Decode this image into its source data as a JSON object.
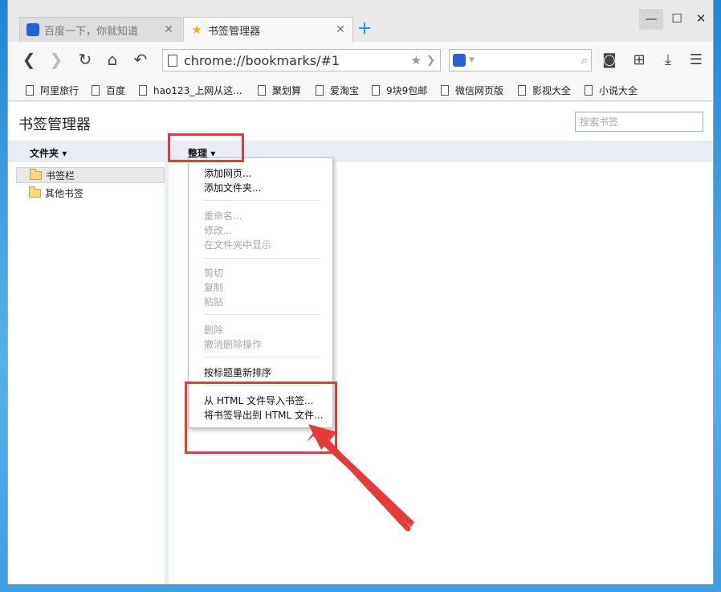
{
  "tabs": [
    {
      "title": "百度一下，你就知道",
      "icon": "baidu-paw-icon",
      "active": false
    },
    {
      "title": "书签管理器",
      "icon": "star-icon",
      "active": true
    }
  ],
  "tab_close": "✕",
  "new_tab": "+",
  "window_controls": {
    "minimize": "—",
    "maximize": "☐",
    "close": "✕"
  },
  "address_bar": {
    "url": "chrome://bookmarks/#1"
  },
  "search_engine": {
    "icon": "baidu-paw-icon"
  },
  "bookmarks_bar": [
    "阿里旅行",
    "百度",
    "hao123_上网从这...",
    "聚划算",
    "爱淘宝",
    "9块9包邮",
    "微信网页版",
    "影视大全",
    "小说大全"
  ],
  "page": {
    "title": "书签管理器",
    "search_placeholder": "搜索书签",
    "folders_label": "文件夹",
    "organize_label": "整理"
  },
  "folders": [
    {
      "name": "书签栏",
      "selected": true
    },
    {
      "name": "其他书签",
      "selected": false
    }
  ],
  "organize_menu": {
    "add_page": "添加网页...",
    "add_folder": "添加文件夹...",
    "rename": "重命名...",
    "edit": "修改...",
    "show_in_folder": "在文件夹中显示",
    "cut": "剪切",
    "copy": "复制",
    "paste": "粘贴",
    "delete": "删除",
    "undo_delete": "撤消删除操作",
    "sort_by_title": "按标题重新排序",
    "import_html": "从 HTML 文件导入书签...",
    "export_html": "将书签导出到 HTML 文件..."
  },
  "colors": {
    "highlight": "#e53b3b",
    "accent": "#1a8ae0",
    "header_strip": "#e8ecf5"
  }
}
